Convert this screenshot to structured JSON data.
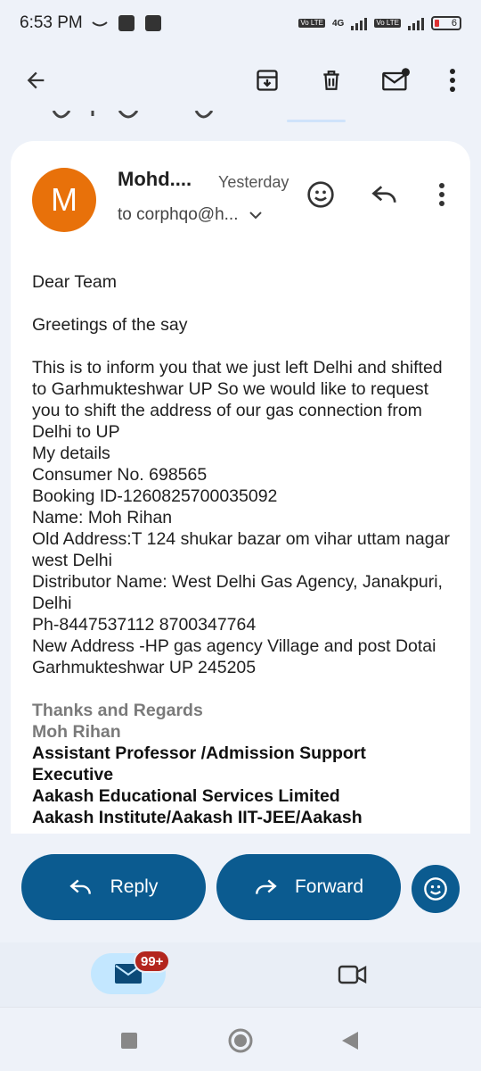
{
  "status": {
    "time": "6:53 PM",
    "network": "4G",
    "volte_label": "Vo LTE",
    "battery": "6"
  },
  "toolbar": {
    "icons": [
      "back-arrow-icon",
      "archive-icon",
      "trash-icon",
      "mark-unread-icon",
      "more-vert-icon"
    ]
  },
  "email": {
    "avatar_letter": "M",
    "avatar_color": "#e8710a",
    "sender": "Mohd....",
    "date": "Yesterday",
    "recipient": "to corphqo@h...",
    "greeting": "Dear Team",
    "opening": "Greetings of the say",
    "paragraph": "This is to inform you that we just left Delhi and shifted to Garhmukteshwar UP So we would like to request you to shift the address of our gas connection from Delhi to UP",
    "details_heading": "My details",
    "consumer_no": "Consumer No. 698565",
    "booking_id": "Booking ID-1260825700035092",
    "name": "Name: Moh Rihan",
    "old_address": "Old Address:T 124 shukar bazar om vihar uttam nagar west Delhi",
    "distributor": "Distributor Name: West Delhi Gas Agency, Janakpuri, Delhi",
    "phone": "Ph-8447537112 8700347764",
    "new_address": "New Address -HP gas agency Village and post Dotai Garhmukteshwar UP 245205",
    "sign_off": "Thanks and Regards",
    "sign_name": "Moh Rihan",
    "sign_title": "Assistant Professor /Admission Support Executive",
    "sign_company": "Aakash Educational Services Limited",
    "sign_extra": "Aakash Institute/Aakash IIT-JEE/Aakash"
  },
  "actions": {
    "reply_label": "Reply",
    "forward_label": "Forward"
  },
  "bottom_nav": {
    "mail_badge": "99+"
  },
  "colors": {
    "accent": "#0b5b90",
    "badge": "#b3261e",
    "mail_pill": "#c3e7ff"
  }
}
